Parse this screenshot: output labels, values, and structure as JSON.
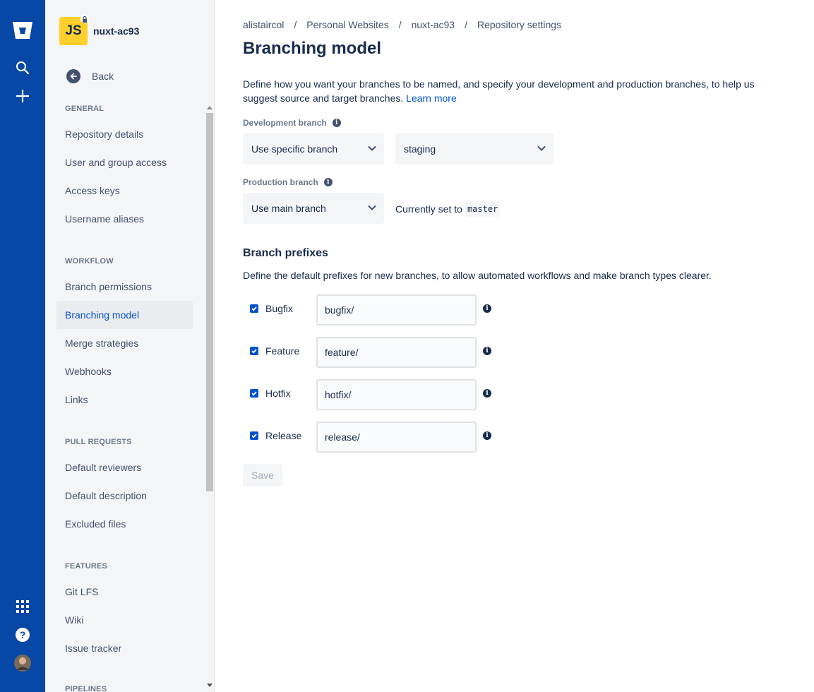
{
  "rail": {
    "logo": "bitbucket-logo-icon",
    "top_icons": [
      "search-icon",
      "plus-icon"
    ],
    "bottom_icons": [
      "app-switcher-icon",
      "help-icon",
      "user-avatar"
    ]
  },
  "repo": {
    "avatar_initials": "JS",
    "name": "nuxt-ac93"
  },
  "sidebar": {
    "back_label": "Back",
    "groups": [
      {
        "title": "GENERAL",
        "items": [
          "Repository details",
          "User and group access",
          "Access keys",
          "Username aliases"
        ]
      },
      {
        "title": "WORKFLOW",
        "items": [
          "Branch permissions",
          "Branching model",
          "Merge strategies",
          "Webhooks",
          "Links"
        ]
      },
      {
        "title": "PULL REQUESTS",
        "items": [
          "Default reviewers",
          "Default description",
          "Excluded files"
        ]
      },
      {
        "title": "FEATURES",
        "items": [
          "Git LFS",
          "Wiki",
          "Issue tracker"
        ]
      },
      {
        "title": "PIPELINES",
        "items": []
      }
    ],
    "active_item": "Branching model"
  },
  "breadcrumb": [
    "alistaircol",
    "Personal Websites",
    "nuxt-ac93",
    "Repository settings"
  ],
  "breadcrumb_sep": "/",
  "page": {
    "title": "Branching model",
    "intro": "Define how you want your branches to be named, and specify your development and production branches, to help us suggest source and target branches.",
    "learn_more": "Learn more",
    "development": {
      "label": "Development branch",
      "mode": "Use specific branch",
      "branch": "staging"
    },
    "production": {
      "label": "Production branch",
      "mode": "Use main branch",
      "current_text": "Currently set to",
      "current_value": "master"
    },
    "prefixes_title": "Branch prefixes",
    "prefixes_desc": "Define the default prefixes for new branches, to allow automated workflows and make branch types clearer.",
    "prefixes": [
      {
        "label": "Bugfix",
        "value": "bugfix/",
        "checked": true
      },
      {
        "label": "Feature",
        "value": "feature/",
        "checked": true
      },
      {
        "label": "Hotfix",
        "value": "hotfix/",
        "checked": true
      },
      {
        "label": "Release",
        "value": "release/",
        "checked": true
      }
    ],
    "save_label": "Save"
  },
  "colors": {
    "rail": "#0747A6",
    "accent": "#0052CC",
    "avatar": "#FFD02B",
    "text": "#172B4D"
  }
}
